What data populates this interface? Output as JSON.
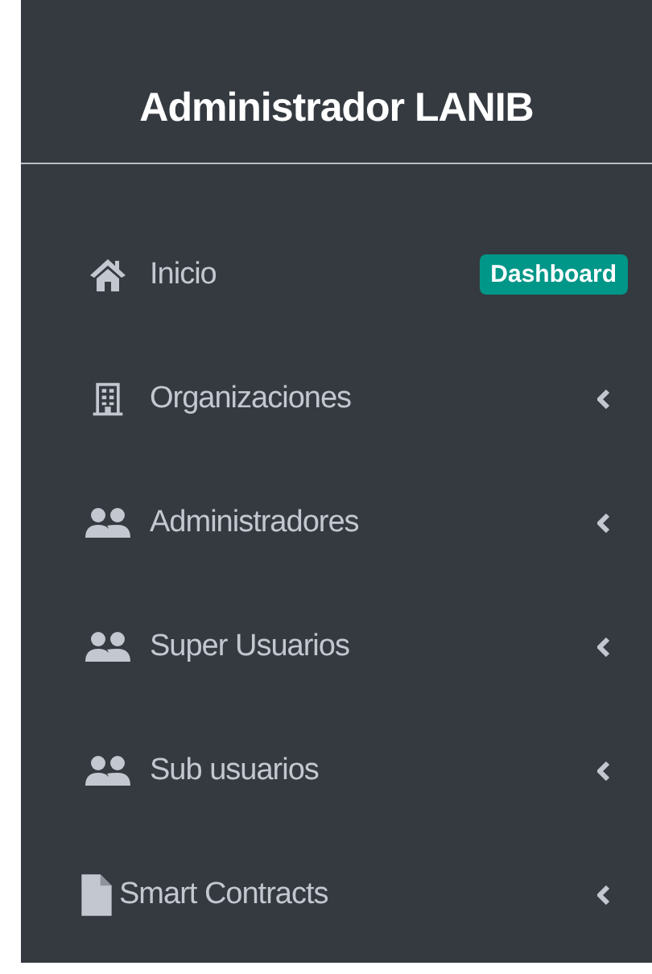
{
  "sidebar": {
    "title": "Administrador LANIB",
    "items": [
      {
        "kind": "home",
        "label": "Inicio",
        "badge": "Dashboard",
        "has_submenu": false
      },
      {
        "kind": "building",
        "label": "Organizaciones",
        "has_submenu": true
      },
      {
        "kind": "users",
        "label": "Administradores",
        "has_submenu": true
      },
      {
        "kind": "users",
        "label": "Super Usuarios",
        "has_submenu": true
      },
      {
        "kind": "users",
        "label": "Sub usuarios",
        "has_submenu": true
      },
      {
        "kind": "file",
        "label": "Smart Contracts",
        "has_submenu": true
      }
    ]
  }
}
